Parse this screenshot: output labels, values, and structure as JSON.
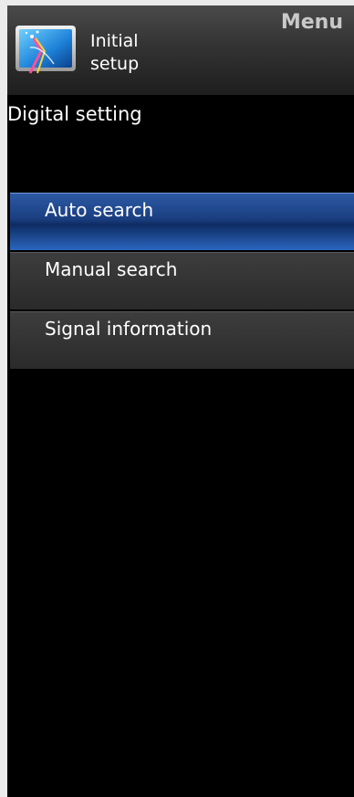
{
  "header": {
    "title": "Initial\nsetup",
    "menu_label": "Menu",
    "icon": "tv-setup-icon"
  },
  "section": {
    "title": "Digital setting"
  },
  "menu": {
    "items": [
      {
        "label": "Auto search",
        "selected": true
      },
      {
        "label": "Manual search",
        "selected": false
      },
      {
        "label": "Signal information",
        "selected": false
      }
    ]
  },
  "colors": {
    "selected_accent": "#1a3e80",
    "background": "#000000"
  }
}
